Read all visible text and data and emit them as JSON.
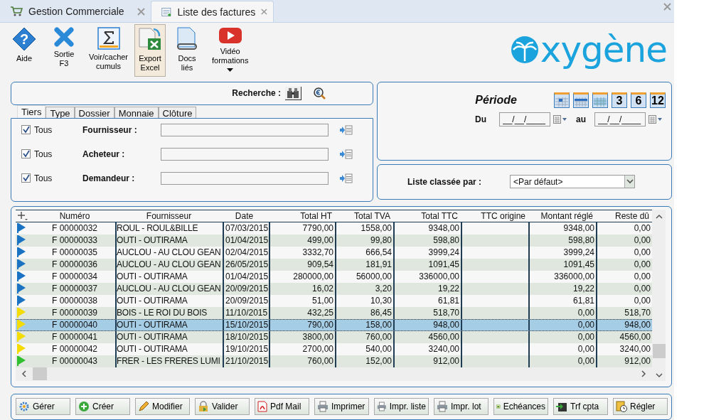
{
  "tabs": [
    {
      "label": "Gestion Commerciale",
      "kind": "cart",
      "selected": false
    },
    {
      "label": "Liste des factures",
      "kind": "list",
      "selected": true
    }
  ],
  "toolbar": [
    {
      "kind": "help",
      "glyph": "?",
      "lines": [
        "Aide"
      ],
      "selected": false
    },
    {
      "kind": "exit",
      "lines": [
        "Sortie",
        "F3"
      ],
      "selected": false
    },
    {
      "kind": "sum",
      "lines": [
        "Voir/cacher",
        "cumuls"
      ],
      "selected": false
    },
    {
      "kind": "excel",
      "lines": [
        "Export",
        "Excel"
      ],
      "selected": true
    },
    {
      "kind": "docs",
      "lines": [
        "Docs",
        "liés"
      ],
      "selected": false
    },
    {
      "kind": "video",
      "lines": [
        "Vidéo",
        "formations"
      ],
      "selected": false,
      "dropdown": true
    }
  ],
  "logo": {
    "text": "xygène"
  },
  "search": {
    "label": "Recherche :"
  },
  "filter_tabs": [
    {
      "label": "Tiers",
      "selected": true
    },
    {
      "label": "Type",
      "selected": false
    },
    {
      "label": "Dossier",
      "selected": false
    },
    {
      "label": "Monnaie",
      "selected": false
    },
    {
      "label": "Clôture",
      "selected": false
    }
  ],
  "filters": [
    {
      "all_label": "Tous",
      "checked": true,
      "label": "Fournisseur :"
    },
    {
      "all_label": "Tous",
      "checked": true,
      "label": "Acheteur :"
    },
    {
      "all_label": "Tous",
      "checked": true,
      "label": "Demandeur :"
    }
  ],
  "period": {
    "title": "Période",
    "presets": [
      {
        "kind": "day"
      },
      {
        "kind": "week"
      },
      {
        "kind": "month"
      },
      {
        "kind": "number",
        "label": "3"
      },
      {
        "kind": "number",
        "label": "6"
      },
      {
        "kind": "number",
        "label": "12"
      }
    ],
    "from_label": "Du",
    "from_value": "__/__/____",
    "to_label": "au",
    "to_value": "__/__/____"
  },
  "sort": {
    "label": "Liste classée par :",
    "value": "<Par défaut>"
  },
  "table": {
    "columns": [
      "Numéro",
      "Fournisseur",
      "Date",
      "Total HT",
      "Total TVA",
      "Total TTC",
      "TTC origine",
      "Montant réglé",
      "Reste dû"
    ],
    "rows": [
      {
        "color": "#1a72c2",
        "selected": false,
        "cells": [
          "F 00000032",
          "ROUL - ROUL&BILLE",
          "07/03/2015",
          "7790,00",
          "1558,00",
          "9348,00",
          "",
          "9348,00",
          "0,00"
        ]
      },
      {
        "color": "#1a72c2",
        "selected": false,
        "cells": [
          "F 00000033",
          "OUTI - OUTIRAMA",
          "01/04/2015",
          "499,00",
          "99,80",
          "598,80",
          "",
          "598,80",
          "0,00"
        ]
      },
      {
        "color": "#1a72c2",
        "selected": false,
        "cells": [
          "F 00000035",
          "AUCLOU - AU CLOU GEAN",
          "02/04/2015",
          "3332,70",
          "666,54",
          "3999,24",
          "",
          "3999,24",
          "0,00"
        ]
      },
      {
        "color": "#1a72c2",
        "selected": false,
        "cells": [
          "F 00000036",
          "AUCLOU - AU CLOU GEAN",
          "26/05/2015",
          "909,54",
          "181,91",
          "1091,45",
          "",
          "1091,45",
          "0,00"
        ]
      },
      {
        "color": "#1a72c2",
        "selected": false,
        "cells": [
          "F 00000034",
          "OUTI - OUTIRAMA",
          "01/04/2015",
          "280000,00",
          "56000,00",
          "336000,00",
          "",
          "336000,00",
          "0,00"
        ]
      },
      {
        "color": "#1a72c2",
        "selected": false,
        "cells": [
          "F 00000037",
          "AUCLOU - AU CLOU GEAN",
          "20/09/2015",
          "16,02",
          "3,20",
          "19,22",
          "",
          "19,22",
          "0,00"
        ]
      },
      {
        "color": "#1a72c2",
        "selected": false,
        "cells": [
          "F 00000038",
          "OUTI - OUTIRAMA",
          "20/09/2015",
          "51,00",
          "10,30",
          "61,81",
          "",
          "61,81",
          "0,00"
        ]
      },
      {
        "color": "#f5dc00",
        "selected": false,
        "cells": [
          "F 00000039",
          "BOIS - LE ROI DU BOIS",
          "11/10/2015",
          "432,25",
          "86,45",
          "518,70",
          "",
          "0,00",
          "518,70"
        ]
      },
      {
        "color": "#f5dc00",
        "selected": true,
        "cells": [
          "F 00000040",
          "OUTI - OUTIRAMA",
          "15/10/2015",
          "790,00",
          "158,00",
          "948,00",
          "",
          "0,00",
          "948,00"
        ]
      },
      {
        "color": "#f5dc00",
        "selected": false,
        "cells": [
          "F 00000041",
          "OUTI - OUTIRAMA",
          "18/10/2015",
          "3800,00",
          "760,00",
          "4560,00",
          "",
          "0,00",
          "4560,00"
        ]
      },
      {
        "color": "#f5dc00",
        "selected": false,
        "cells": [
          "F 00000042",
          "OUTI - OUTIRAMA",
          "19/10/2015",
          "2700,00",
          "540,00",
          "3240,00",
          "",
          "0,00",
          "3240,00"
        ]
      },
      {
        "color": "#2fbf2f",
        "selected": false,
        "cells": [
          "F 00000043",
          "FRER - LES FRERES LUMI",
          "21/10/2015",
          "760,00",
          "152,00",
          "912,00",
          "",
          "0,00",
          "912,00"
        ]
      }
    ]
  },
  "actions": [
    {
      "kind": "gear",
      "label": "Gérer"
    },
    {
      "kind": "plus",
      "label": "Créer"
    },
    {
      "kind": "pencil",
      "label": "Modifier"
    },
    {
      "kind": "lock",
      "label": "Valider"
    },
    {
      "kind": "pdf",
      "label": "Pdf Mail"
    },
    {
      "kind": "printer",
      "label": "Imprimer"
    },
    {
      "kind": "printer",
      "label": "Impr. liste"
    },
    {
      "kind": "printer",
      "label": "Impr. lot"
    },
    {
      "kind": "calendar",
      "label": "Echéances"
    },
    {
      "kind": "transfer",
      "label": "Trf cpta"
    },
    {
      "kind": "clock",
      "label": "Régler"
    }
  ]
}
